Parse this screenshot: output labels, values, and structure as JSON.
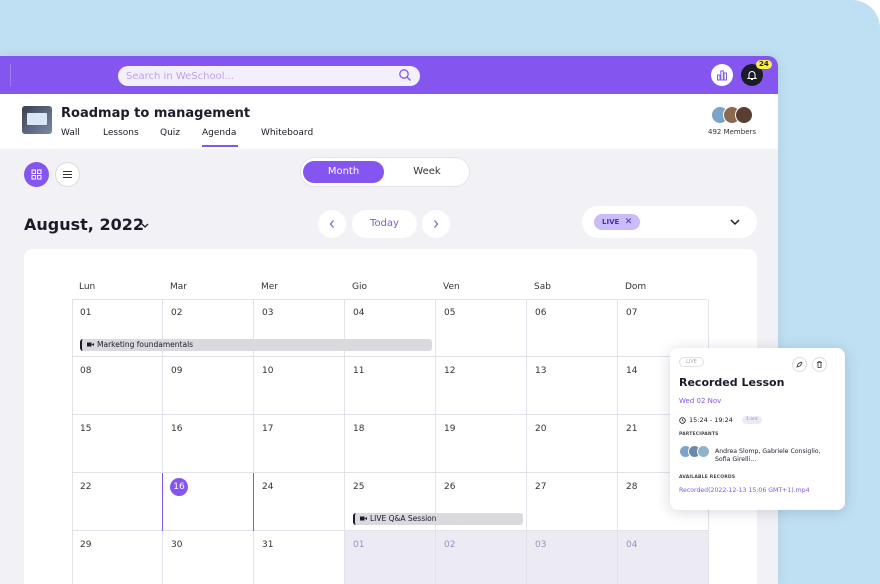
{
  "colors": {
    "accent": "#8456ef",
    "topbar": "#8456ef",
    "background": "#bfe0f2"
  },
  "topbar": {
    "search_placeholder": "Search in WeSchool...",
    "notification_count": "24",
    "icons": [
      "search-icon",
      "chart-icon",
      "bell-icon"
    ]
  },
  "group": {
    "title": "Roadmap to management",
    "more": "···",
    "members": "492 Members",
    "tabs": [
      {
        "label": "Wall"
      },
      {
        "label": "Lessons"
      },
      {
        "label": "Quiz"
      },
      {
        "label": "Agenda",
        "active": true
      },
      {
        "label": "Whiteboard"
      }
    ]
  },
  "toolbar": {
    "view_modes": [
      "grid-icon",
      "list-icon"
    ],
    "segment": {
      "month": "Month",
      "week": "Week"
    }
  },
  "calendar": {
    "month_label": "August, 2022",
    "today_label": "Today",
    "filter_chip": "LIVE",
    "weekdays": [
      "Lun",
      "Mar",
      "Mer",
      "Gio",
      "Ven",
      "Sab",
      "Dom"
    ],
    "weeks": [
      [
        {
          "d": "01"
        },
        {
          "d": "02"
        },
        {
          "d": "03"
        },
        {
          "d": "04"
        },
        {
          "d": "05"
        },
        {
          "d": "06"
        },
        {
          "d": "07"
        }
      ],
      [
        {
          "d": "08"
        },
        {
          "d": "09"
        },
        {
          "d": "10"
        },
        {
          "d": "11"
        },
        {
          "d": "12"
        },
        {
          "d": "13"
        },
        {
          "d": "14"
        }
      ],
      [
        {
          "d": "15"
        },
        {
          "d": "16"
        },
        {
          "d": "17"
        },
        {
          "d": "18"
        },
        {
          "d": "19"
        },
        {
          "d": "20"
        },
        {
          "d": "21"
        }
      ],
      [
        {
          "d": "22"
        },
        {
          "d": "16",
          "today": true
        },
        {
          "d": "24"
        },
        {
          "d": "25"
        },
        {
          "d": "26"
        },
        {
          "d": "27"
        },
        {
          "d": "28"
        }
      ],
      [
        {
          "d": "29"
        },
        {
          "d": "30"
        },
        {
          "d": "31"
        },
        {
          "d": "01",
          "other": true
        },
        {
          "d": "02",
          "other": true
        },
        {
          "d": "03",
          "other": true
        },
        {
          "d": "04",
          "other": true
        }
      ]
    ],
    "events": [
      {
        "title": "Marketing foundamentals",
        "week": 0,
        "start": 0,
        "span": 4
      },
      {
        "title": "LIVE Q&A Session",
        "week": 3,
        "start": 3,
        "span": 2
      }
    ]
  },
  "popup": {
    "live": "LIVE",
    "title": "Recorded Lesson",
    "date": "Wed 02 Nov",
    "time": "15:24 - 19:24",
    "time_pill": "1 ora",
    "participants_label": "PARTECIPANTS",
    "participants": "Andrea Slomp, Gabriele Consiglio, Sofia Girelli...",
    "records_label": "AVAILABLE RECORDS",
    "record": "Recorded(2022-12-13 15:06 GMT+1).mp4"
  }
}
